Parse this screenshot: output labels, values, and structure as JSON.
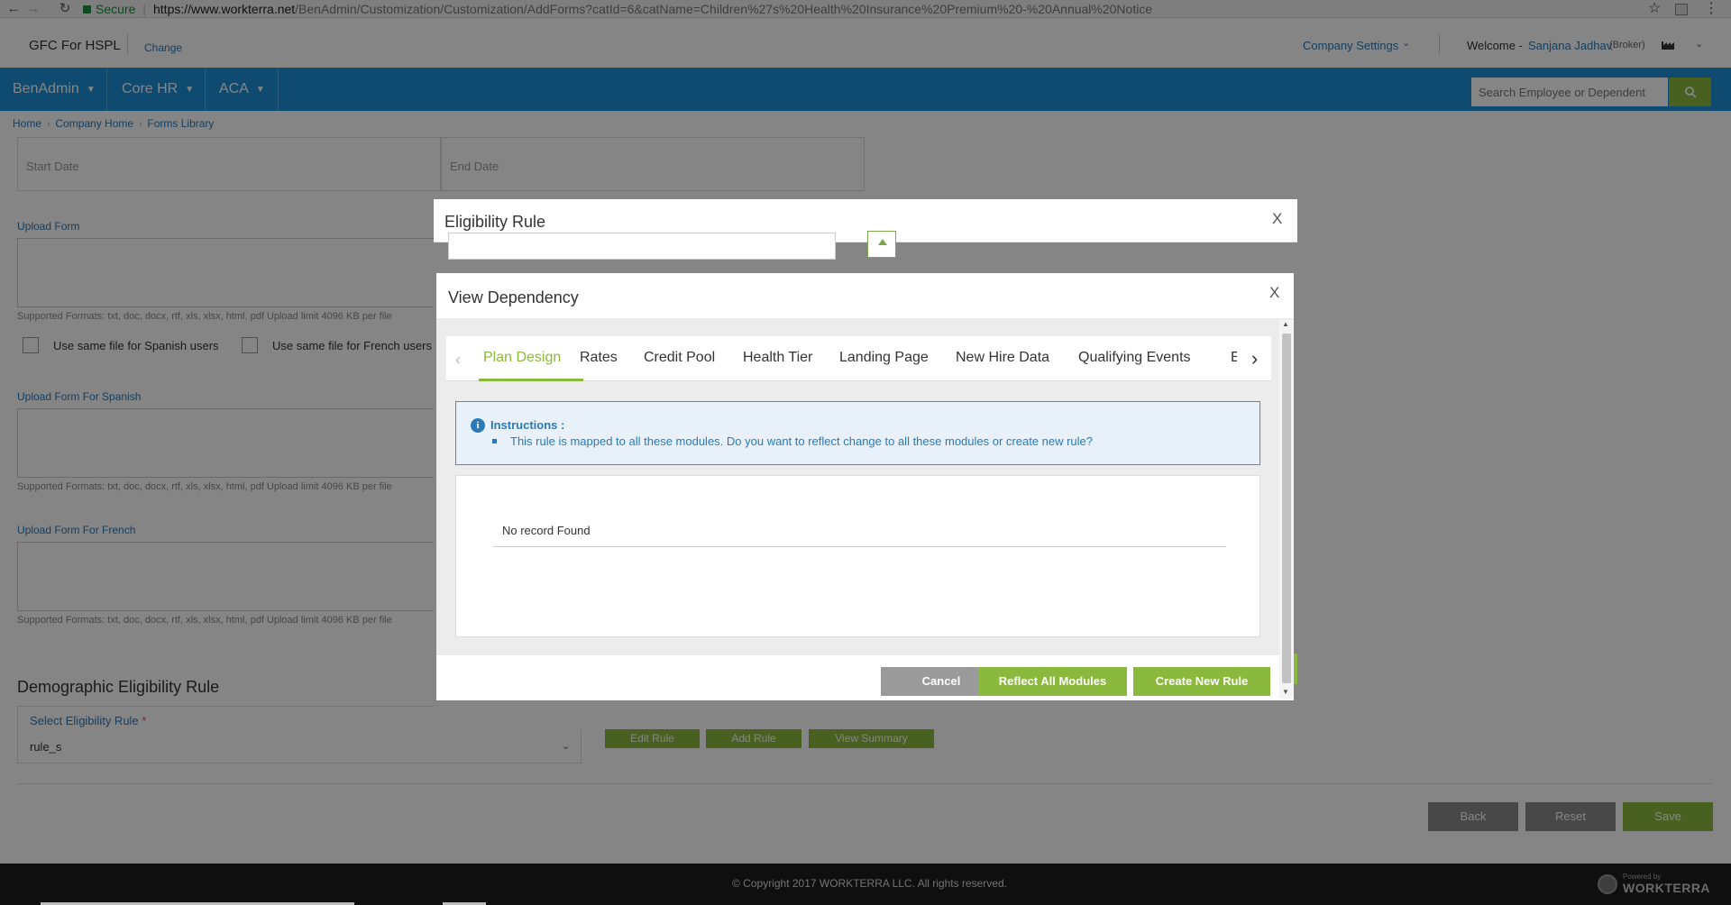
{
  "browser": {
    "back_icon": "←",
    "forward_icon": "→",
    "reload_icon": "↻",
    "secure_label": "Secure",
    "url_host": "https://www.workterra.net",
    "url_path": "/BenAdmin/Customization/Customization/AddForms?catId=6&catName=Children%27s%20Health%20Insurance%20Premium%20-%20Annual%20Notice",
    "star_icon": "☆",
    "menu_icon": "⋮"
  },
  "header": {
    "company": "GFC For HSPL",
    "change_label": "Change",
    "company_settings": "Company Settings",
    "welcome": "Welcome -",
    "user_name": "Sanjana Jadhav",
    "role": "(Broker)"
  },
  "nav": {
    "items": [
      {
        "label": "BenAdmin"
      },
      {
        "label": "Core HR"
      },
      {
        "label": "ACA"
      }
    ],
    "search_placeholder": "Search Employee or Dependent"
  },
  "breadcrumb": [
    "Home",
    "Company Home",
    "Forms Library"
  ],
  "form": {
    "start_date": "Start Date",
    "end_date": "End Date",
    "upload_form": "Upload Form",
    "formats": "Supported Formats: txt, doc, docx, rtf, xls, xlsx, html, pdf Upload limit 4096 KB per file",
    "same_spanish": "Use same file for Spanish users",
    "same_french": "Use same file for French users",
    "upload_spanish": "Upload Form For Spanish",
    "upload_french": "Upload Form For French",
    "demographic_title": "Demographic Eligibility Rule",
    "select_rule_label": "Select Eligibility Rule",
    "required_mark": "*",
    "select_rule_value": "rule_s",
    "edit_rule": "Edit Rule",
    "add_rule": "Add Rule",
    "view_summary": "View Summary",
    "back": "Back",
    "reset": "Reset",
    "save": "Save"
  },
  "footer": {
    "copyright": "© Copyright 2017 WORKTERRA LLC. All rights reserved.",
    "powered_by": "Powered by",
    "brand": "WORKTERRA"
  },
  "eligibility_modal": {
    "title": "Eligibility Rule",
    "close": "X"
  },
  "dependency_modal": {
    "title": "View Dependency",
    "close": "X",
    "tabs": [
      {
        "label": "Plan Design",
        "active": true
      },
      {
        "label": "Rates"
      },
      {
        "label": "Credit Pool"
      },
      {
        "label": "Health Tier"
      },
      {
        "label": "Landing Page"
      },
      {
        "label": "New Hire Data"
      },
      {
        "label": "Qualifying Events"
      },
      {
        "label": "E"
      }
    ],
    "instructions_title": "Instructions :",
    "instructions_text": "This rule is mapped to all these modules. Do you want to reflect change to all these modules or create new rule?",
    "no_record": "No record Found",
    "cancel": "Cancel",
    "reflect_all": "Reflect All Modules",
    "create_new": "Create New Rule"
  },
  "colors": {
    "nav_blue": "#1d8fd8",
    "accent_green": "#8bb93e",
    "link_blue": "#2a7ab8"
  }
}
